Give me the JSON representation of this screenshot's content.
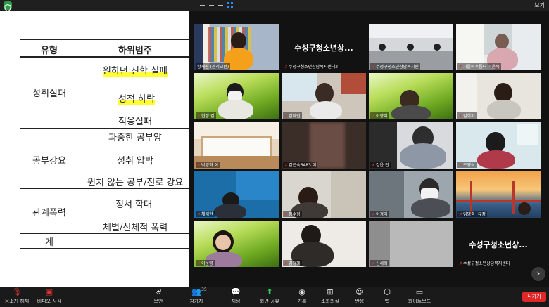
{
  "window": {
    "view_label": "보기"
  },
  "doc": {
    "header": {
      "col1": "유형",
      "col2": "하위범주"
    },
    "rows": [
      {
        "type": "성취실패",
        "items": [
          "원하던 진학 실패",
          "성적 하락",
          "적응실패"
        ]
      },
      {
        "type": "공부강요",
        "items": [
          "과중한 공부양",
          "성취 압박",
          "원치 않는 공부/진로 강요"
        ]
      },
      {
        "type": "관계폭력",
        "items": [
          "정서 학대",
          "체벌/신체적 폭력"
        ]
      },
      {
        "type": "계",
        "items": []
      }
    ]
  },
  "tiles": [
    {
      "name": "황재원 (관리교환)",
      "muted": false
    },
    {
      "name": "수성구청소년상담복지센터2",
      "muted": true,
      "big": "수성구청소년상..."
    },
    {
      "name": "수성구청소년상담복지센",
      "muted": true
    },
    {
      "name": "가톨릭푸름터 이윤숙",
      "muted": true
    },
    {
      "name": "현정 김",
      "muted": true
    },
    {
      "name": "김혜빈",
      "muted": true
    },
    {
      "name": "이향미",
      "muted": true
    },
    {
      "name": "김희자",
      "muted": true
    },
    {
      "name": "박경화 여",
      "muted": true
    },
    {
      "name": "김은숙6483 여",
      "muted": true
    },
    {
      "name": "김윤 진",
      "muted": true
    },
    {
      "name": "조영석",
      "muted": true
    },
    {
      "name": "채재현",
      "muted": true
    },
    {
      "name": "정수정",
      "muted": true
    },
    {
      "name": "이경아",
      "muted": true
    },
    {
      "name": "임명숙 (유정",
      "muted": true
    },
    {
      "name": "이운영",
      "muted": true
    },
    {
      "name": "김정혜",
      "muted": true
    },
    {
      "name": "신세희",
      "muted": true
    },
    {
      "name": "수성구청소년상담복지센터",
      "muted": true,
      "big": "수성구청소년상..."
    }
  ],
  "toolbar": {
    "unmute": "음소거 해제",
    "start_video": "비디오 시작",
    "security": "보안",
    "participants": "참가자",
    "participants_count": "35",
    "chat": "채팅",
    "share_screen": "화면 공유",
    "record": "기록",
    "breakout": "소회의실",
    "reactions": "반응",
    "apps": "앱",
    "whiteboard": "화이트보드",
    "leave": "나가기"
  },
  "colors": {
    "accent_green": "#2fd35b",
    "active_speaker": "#9ad433",
    "leave_red": "#e02828",
    "muted_red": "#e0332f"
  }
}
